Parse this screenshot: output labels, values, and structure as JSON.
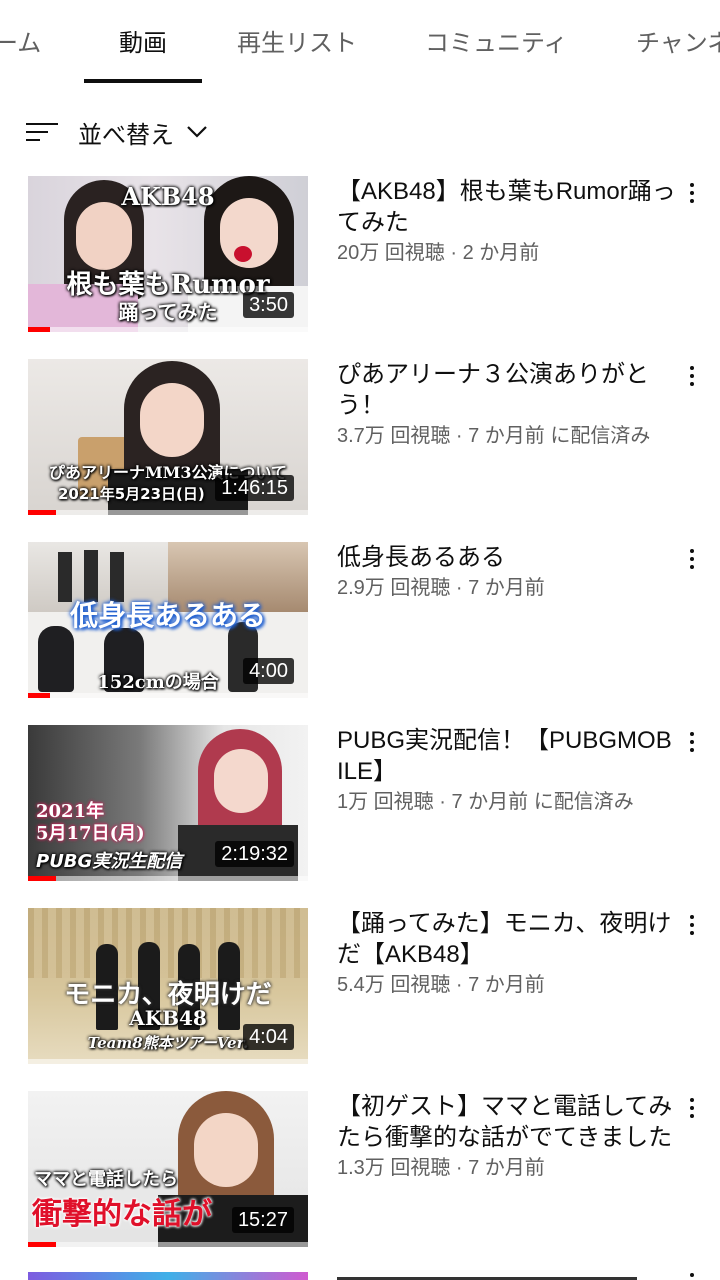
{
  "tabs": [
    {
      "label": "ホーム",
      "visible_text": "ーム",
      "active": false
    },
    {
      "label": "動画",
      "active": true
    },
    {
      "label": "再生リスト",
      "active": false
    },
    {
      "label": "コミュニティ",
      "active": false
    },
    {
      "label": "チャンネ",
      "active": false
    }
  ],
  "sort": {
    "label": "並べ替え",
    "icon": "sort-icon",
    "chevron": "chevron-down-icon"
  },
  "videos": [
    {
      "title": "【AKB48】根も葉もRumor踊ってみた",
      "meta": "20万 回視聴 · 2 か月前",
      "duration": "3:50",
      "thumb_text_1": "AKB48",
      "thumb_text_2": "根も葉もRumor",
      "thumb_text_3": "踊ってみた",
      "watched_fraction": 0.08
    },
    {
      "title": "ぴあアリーナ３公演ありがとう！",
      "meta": "3.7万 回視聴 · 7 か月前 に配信済み",
      "duration": "1:46:15",
      "thumb_text_1": "ぴあアリーナMM3公演について",
      "thumb_text_2": "2021年5月23日(日)",
      "watched_fraction": 0.1
    },
    {
      "title": "低身長あるある",
      "meta": "2.9万 回視聴 · 7 か月前",
      "duration": "4:00",
      "thumb_text_1": "低身長あるある",
      "thumb_text_2": "152cmの場合",
      "watched_fraction": 0.08
    },
    {
      "title": "PUBG実況配信！【PUBGMOBILE】",
      "meta": "1万 回視聴 · 7 か月前 に配信済み",
      "duration": "2:19:32",
      "thumb_text_1": "2021年",
      "thumb_text_2": "5月17日(月)",
      "thumb_text_3": "PUBG実況生配信",
      "watched_fraction": 0.1
    },
    {
      "title": "【踊ってみた】モニカ、夜明けだ【AKB48】",
      "meta": "5.4万 回視聴 · 7 か月前",
      "duration": "4:04",
      "thumb_text_1": "モニカ、夜明けだ",
      "thumb_text_2": "AKB48",
      "thumb_text_3": "Team8熊本ツアーVer.",
      "watched_fraction": 0.0
    },
    {
      "title": "【初ゲスト】ママと電話してみたら衝撃的な話がでてきました",
      "meta": "1.3万 回視聴 · 7 か月前",
      "duration": "15:27",
      "thumb_text_1": "ママと電話したら",
      "thumb_text_2": "衝撃的な話が",
      "watched_fraction": 0.1
    }
  ],
  "colors": {
    "progress": "#ff0000",
    "meta_text": "#606060",
    "tab_inactive": "#606060"
  }
}
